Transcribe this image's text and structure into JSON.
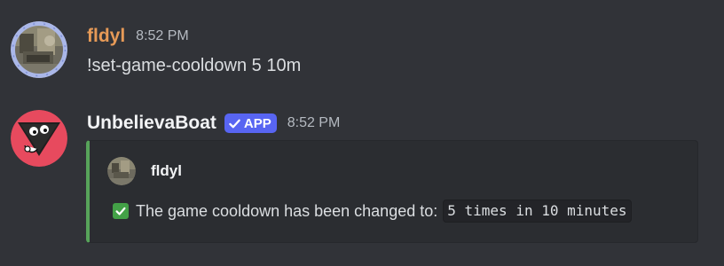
{
  "messages": [
    {
      "author": "fldyl",
      "author_color": "#e69a57",
      "time": "8:52 PM",
      "content": "!set-game-cooldown 5 10m"
    },
    {
      "author": "UnbelievaBoat",
      "author_color": "#f2f3f5",
      "badge": "APP",
      "badge_color": "#5865f2",
      "time": "8:52 PM",
      "embed": {
        "accent_color": "#57a35a",
        "author_name": "fldyl",
        "description_icon": "white-check-mark-emoji",
        "description_text": "The game cooldown has been changed to:",
        "code_value": "5 times in 10 minutes"
      }
    }
  ],
  "colors": {
    "background": "#313338",
    "embed_background": "#2b2d31"
  }
}
